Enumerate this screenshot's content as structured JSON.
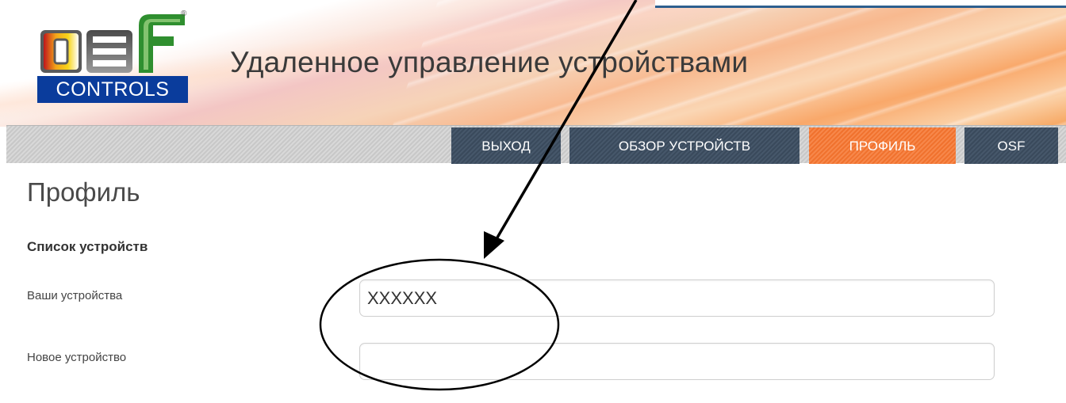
{
  "header": {
    "logo_text": "CONTROLS",
    "logo_letters": "osf",
    "registered_mark": "®",
    "title": "Удаленное управление устройствами"
  },
  "nav": {
    "tabs": [
      {
        "label": "ВЫХОД",
        "active": false
      },
      {
        "label": "ОБЗОР УСТРОЙСТВ",
        "active": false
      },
      {
        "label": "ПРОФИЛЬ",
        "active": true
      },
      {
        "label": "OSF",
        "active": false
      }
    ]
  },
  "main": {
    "page_title": "Профиль",
    "section_title": "Список устройств",
    "your_devices": {
      "label": "Ваши устройства",
      "value": "XXXXXX"
    },
    "new_device": {
      "label": "Новое устройство",
      "value": ""
    }
  },
  "colors": {
    "tab_dark": "#3a4a5c",
    "tab_active": "#f0722e",
    "logo_blue": "#0a3c9c"
  }
}
